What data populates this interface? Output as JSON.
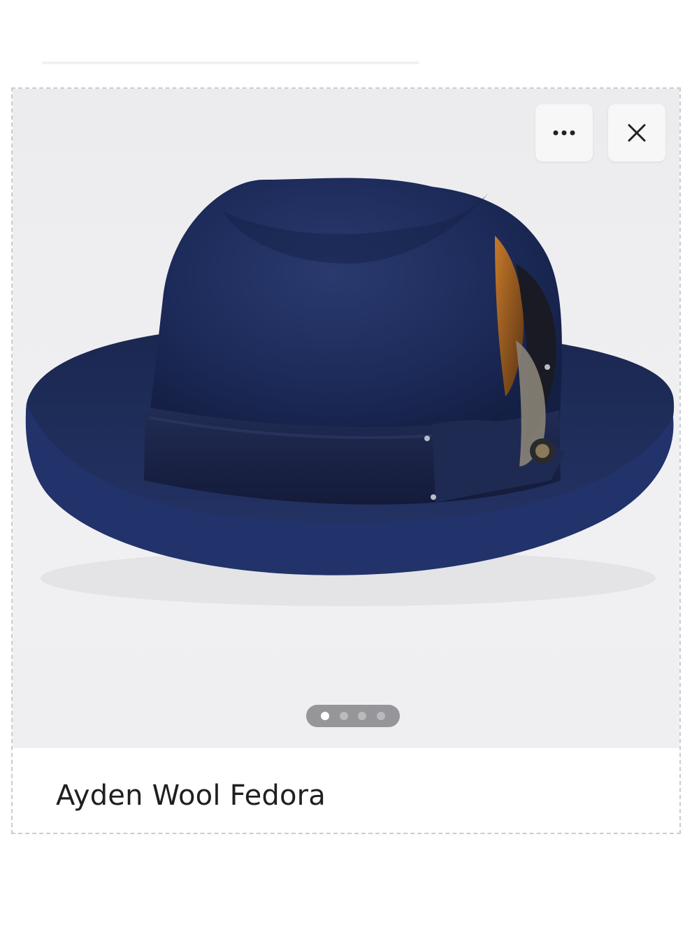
{
  "product": {
    "title": "Ayden Wool Fedora",
    "image_subject": "navy-fedora-hat",
    "carousel": {
      "total": 4,
      "active_index": 0
    }
  },
  "actions": {
    "more_icon": "ellipsis-icon",
    "close_icon": "close-icon"
  },
  "colors": {
    "hat": "#1c2a55",
    "band": "#1a2448",
    "background": "#eeeef0",
    "card_border": "#c9cdd2"
  }
}
